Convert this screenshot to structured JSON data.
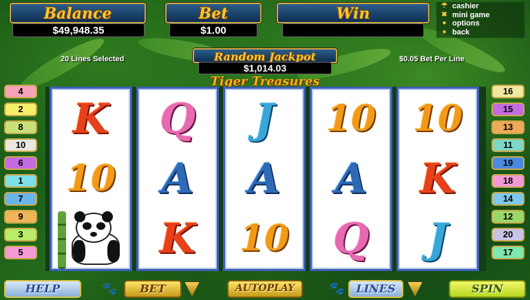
{
  "header": {
    "balance_label": "Balance",
    "balance_value": "$49,948.35",
    "bet_label": "Bet",
    "bet_value": "$1.00",
    "win_label": "Win",
    "win_value": ""
  },
  "menu": [
    {
      "label": "cashier",
      "icon": "cashier-icon"
    },
    {
      "label": "mini game",
      "icon": "mini-game-icon"
    },
    {
      "label": "options",
      "icon": "options-icon"
    },
    {
      "label": "back",
      "icon": "back-icon"
    }
  ],
  "info": {
    "lines_selected": "20 Lines Selected",
    "bet_per_line": "$0.05 Bet Per Line"
  },
  "jackpot": {
    "label": "Random Jackpot",
    "value": "$1,014.03"
  },
  "game_title": "Tiger Treasures",
  "reels": [
    [
      "K",
      "10",
      "panda"
    ],
    [
      "Q",
      "A",
      "K"
    ],
    [
      "J",
      "A",
      "10"
    ],
    [
      "10",
      "A",
      "Q"
    ],
    [
      "10",
      "K",
      "J"
    ]
  ],
  "left_lines": [
    {
      "n": "4",
      "color": "#f4a3b8"
    },
    {
      "n": "2",
      "color": "#f6ef6a"
    },
    {
      "n": "8",
      "color": "#c8e07a"
    },
    {
      "n": "10",
      "color": "#e8e8e0"
    },
    {
      "n": "6",
      "color": "#c46be0"
    },
    {
      "n": "1",
      "color": "#7ee0e8"
    },
    {
      "n": "7",
      "color": "#6ab4ec"
    },
    {
      "n": "9",
      "color": "#f0b45a"
    },
    {
      "n": "3",
      "color": "#b8ec6a"
    },
    {
      "n": "5",
      "color": "#f49ad8"
    }
  ],
  "right_lines": [
    {
      "n": "16",
      "color": "#f0e8a0"
    },
    {
      "n": "15",
      "color": "#c46be0"
    },
    {
      "n": "13",
      "color": "#f0a85a"
    },
    {
      "n": "11",
      "color": "#7ed8c8"
    },
    {
      "n": "19",
      "color": "#4a8ae0"
    },
    {
      "n": "18",
      "color": "#f49ad8"
    },
    {
      "n": "14",
      "color": "#7ec8ec"
    },
    {
      "n": "12",
      "color": "#9ad86a"
    },
    {
      "n": "20",
      "color": "#c8c4e8"
    },
    {
      "n": "17",
      "color": "#7ee8b0"
    }
  ],
  "buttons": {
    "help": "HELP",
    "bet": "BET",
    "autoplay": "AUTOPLAY",
    "lines": "LINES",
    "spin": "SPIN"
  }
}
